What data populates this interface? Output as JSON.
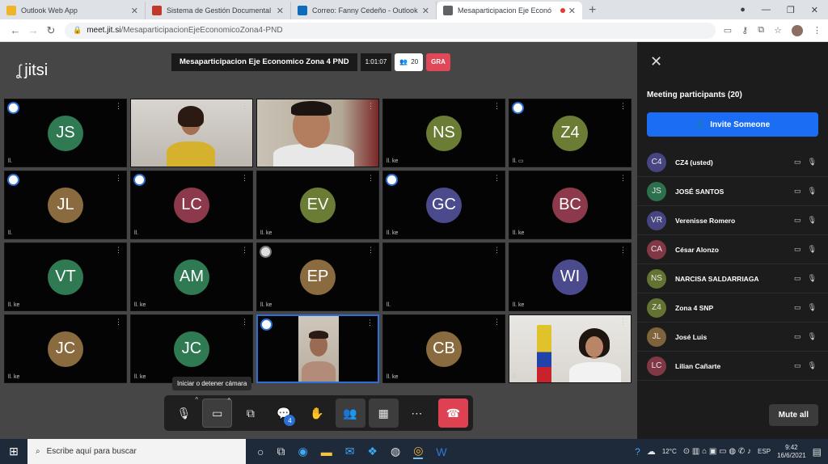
{
  "browser": {
    "tabs": [
      {
        "title": "Outlook Web App",
        "favicon_color": "#f0b429",
        "active": false
      },
      {
        "title": "Sistema de Gestión Documental",
        "favicon_color": "#c0392b",
        "active": false
      },
      {
        "title": "Correo: Fanny Cedeño - Outlook",
        "favicon_color": "#0f6cbd",
        "active": false
      },
      {
        "title": "Mesaparticipacion Eje Econó",
        "favicon_color": "#5f6368",
        "active": true
      }
    ],
    "new_tab_icon": "plus-icon",
    "url_host": "meet.jit.si",
    "url_path": "/MesaparticipacionEjeEconomicoZona4-PND"
  },
  "meeting": {
    "logo_text": "jitsi",
    "subject": "Mesaparticipacion Eje Economico Zona 4 PND",
    "timer": "1:01:07",
    "participant_count": "20",
    "recording_label": "GRA"
  },
  "tiles": [
    {
      "initials": "JS",
      "color": "#2f7a53",
      "badge": "blue",
      "status": "ll.",
      "video": null
    },
    {
      "initials": "",
      "color": "",
      "badge": null,
      "status": "",
      "video": "woman-yellow"
    },
    {
      "initials": "",
      "color": "",
      "badge": null,
      "status": "",
      "video": "man-white"
    },
    {
      "initials": "NS",
      "color": "#6b7d34",
      "badge": null,
      "status": "ll. ke",
      "video": null
    },
    {
      "initials": "Z4",
      "color": "#6b7d34",
      "badge": "blue",
      "status": "ll. ▭",
      "video": null
    },
    {
      "initials": "JL",
      "color": "#8a6b3f",
      "badge": "blue",
      "status": "ll.",
      "video": null
    },
    {
      "initials": "LC",
      "color": "#8c3a4b",
      "badge": "blue",
      "status": "ll.",
      "video": null
    },
    {
      "initials": "EV",
      "color": "#6b7d34",
      "badge": null,
      "status": "ll. ke",
      "video": null
    },
    {
      "initials": "GC",
      "color": "#4b4a8c",
      "badge": "blue",
      "status": "ll. ke",
      "video": null
    },
    {
      "initials": "BC",
      "color": "#8c3a4b",
      "badge": null,
      "status": "ll. ke",
      "video": null
    },
    {
      "initials": "VT",
      "color": "#2f7a53",
      "badge": null,
      "status": "ll. ke",
      "video": null
    },
    {
      "initials": "AM",
      "color": "#2f7a53",
      "badge": null,
      "status": "ll. ke",
      "video": null
    },
    {
      "initials": "EP",
      "color": "#8a6b3f",
      "badge": "grey",
      "status": "ll. ke",
      "video": null
    },
    {
      "initials": "",
      "color": "",
      "badge": null,
      "status": "ll.",
      "video": null
    },
    {
      "initials": "WI",
      "color": "#4b4a8c",
      "badge": null,
      "status": "ll. ke",
      "video": null
    },
    {
      "initials": "JC",
      "color": "#8a6b3f",
      "badge": null,
      "status": "ll. ke",
      "video": null
    },
    {
      "initials": "JC",
      "color": "#2f7a53",
      "badge": null,
      "status": "ll. ke",
      "video": null
    },
    {
      "initials": "",
      "color": "",
      "badge": "blue",
      "status": "",
      "video": "man-portrait",
      "active": true
    },
    {
      "initials": "CB",
      "color": "#8a6b3f",
      "badge": null,
      "status": "ll. ke",
      "video": null
    },
    {
      "initials": "",
      "color": "",
      "badge": null,
      "status": "ll.",
      "video": "woman-flag"
    }
  ],
  "tooltip": "Iniciar o detener cámara",
  "toolbar": {
    "chat_count": "4",
    "buttons": [
      {
        "name": "microphone-toggle-button",
        "icon": "🎙",
        "caret": true
      },
      {
        "name": "camera-toggle-button",
        "icon": "▭",
        "caret": true,
        "selected": true
      },
      {
        "name": "screen-share-button",
        "icon": "⧉"
      },
      {
        "name": "chat-button",
        "icon": "💬",
        "counter": true
      },
      {
        "name": "raise-hand-button",
        "icon": "✋"
      },
      {
        "name": "participants-button",
        "icon": "👥",
        "box": true
      },
      {
        "name": "tile-view-button",
        "icon": "▦",
        "box": true
      },
      {
        "name": "more-options-button",
        "icon": "⋯"
      }
    ]
  },
  "panel": {
    "title": "Meeting participants (20)",
    "invite_label": "Invite Someone",
    "mute_all_label": "Mute all",
    "participants": [
      {
        "initials": "C4",
        "name": "CZ4 (usted)",
        "color": "#4b4a8c"
      },
      {
        "initials": "JS",
        "name": "JOSÉ SANTOS",
        "color": "#2f7a53"
      },
      {
        "initials": "VR",
        "name": "Verenisse Romero",
        "color": "#4b4a8c"
      },
      {
        "initials": "CA",
        "name": "César Alonzo",
        "color": "#8c3a4b"
      },
      {
        "initials": "NS",
        "name": "NARCISA SALDARRIAGA",
        "color": "#6b7d34"
      },
      {
        "initials": "Z4",
        "name": "Zona 4 SNP",
        "color": "#6b7d34"
      },
      {
        "initials": "JL",
        "name": "José Luis",
        "color": "#8a6b3f"
      },
      {
        "initials": "LC",
        "name": "Lilian Cañarte",
        "color": "#8c3a4b"
      }
    ]
  },
  "taskbar": {
    "search_placeholder": "Escribe aquí para buscar",
    "weather": "12°C",
    "language": "ESP",
    "time": "9:42",
    "date": "16/6/2021"
  }
}
